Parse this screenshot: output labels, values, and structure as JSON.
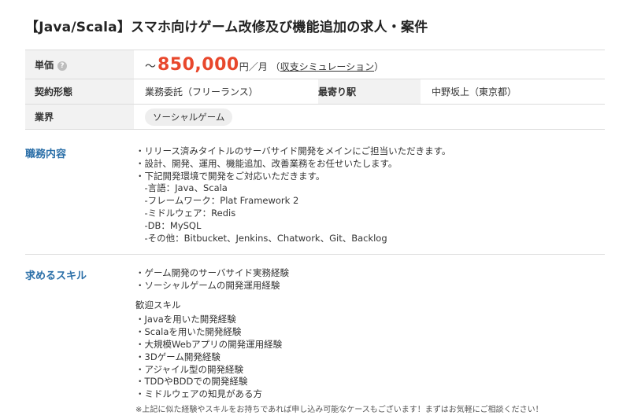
{
  "title": "【Java/Scala】スマホ向けゲーム改修及び機能追加の求人・案件",
  "spec": {
    "price_label": "単価",
    "help_icon_glyph": "?",
    "price_prefix": "～",
    "price_value": "850,000",
    "price_unit": "円／月",
    "simulation_open": "（",
    "simulation_link": "収支シミュレーション",
    "simulation_close": "）",
    "contract_label": "契約形態",
    "contract_value": "業務委託（フリーランス）",
    "station_label": "最寄り駅",
    "station_value": "中野坂上（東京都）",
    "industry_label": "業界",
    "industry_tag": "ソーシャルゲーム"
  },
  "duties": {
    "heading": "職務内容",
    "lines": [
      "・リリース済みタイトルのサーバサイド開発をメインにご担当いただきます。",
      "・設計、開発、運用、機能追加、改善業務をお任せいたします。",
      "・下記開発環境で開発をご対応いただきます。",
      "　-言語：Java、Scala",
      "　-フレームワーク：Plat Framework 2",
      "　-ミドルウェア：Redis",
      "　-DB：MySQL",
      "　-その他：Bitbucket、Jenkins、Chatwork、Git、Backlog"
    ]
  },
  "skills": {
    "heading": "求めるスキル",
    "required": [
      "・ゲーム開発のサーバサイド実務経験",
      "・ソーシャルゲームの開発運用経験"
    ],
    "welcome_heading": "歓迎スキル",
    "welcome": [
      "・Javaを用いた開発経験",
      "・Scalaを用いた開発経験",
      "・大規模Webアプリの開発運用経験",
      "・3Dゲーム開発経験",
      "・アジャイル型の開発経験",
      "・TDDやBDDでの開発経験",
      "・ミドルウェアの知見がある方"
    ],
    "note": "※上記に似た経験やスキルをお持ちであれば申し込み可能なケースもございます！まずはお気軽にご相談ください！"
  },
  "colors": {
    "price": "#e8472c",
    "section_heading": "#2b6fa8",
    "table_header_bg": "#f2f2f2"
  }
}
